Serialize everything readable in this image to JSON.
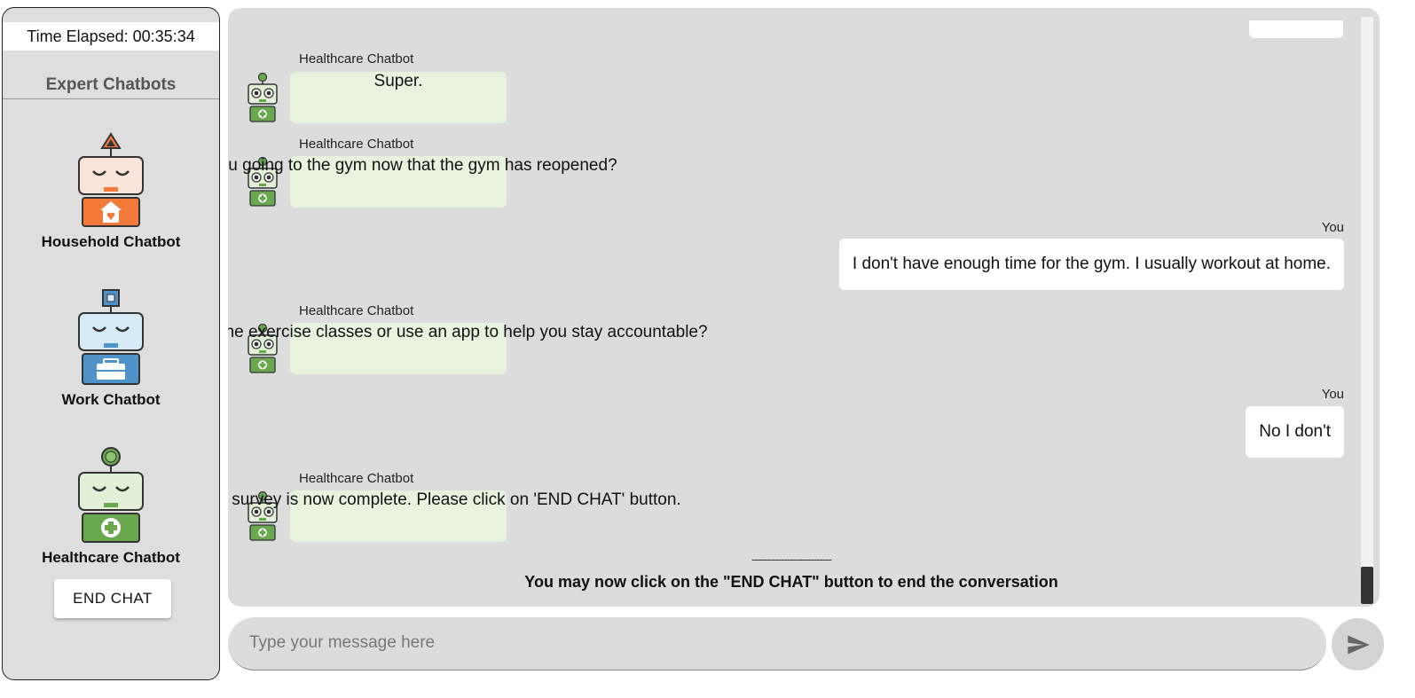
{
  "timer": {
    "label": "Time Elapsed: 00:35:34"
  },
  "sidebar": {
    "title": "Expert Chatbots",
    "bots": [
      {
        "name": "Household Chatbot",
        "icon": "household-robot-icon",
        "accent": "#f47a3a"
      },
      {
        "name": "Work Chatbot",
        "icon": "work-robot-icon",
        "accent": "#4f93c9"
      },
      {
        "name": "Healthcare Chatbot",
        "icon": "healthcare-robot-icon",
        "accent": "#6aa84f"
      }
    ],
    "end_button": "END CHAT"
  },
  "chat": {
    "messages": [
      {
        "from": "bot",
        "sender": "Healthcare Chatbot",
        "text": "Super."
      },
      {
        "from": "bot",
        "sender": "Healthcare Chatbot",
        "text": "Are you going to the gym now that the gym has reopened?"
      },
      {
        "from": "user",
        "sender": "You",
        "text": "I don't have enough time for the gym. I usually workout at home."
      },
      {
        "from": "bot",
        "sender": "Healthcare Chatbot",
        "text": "Do you attend online exercise classes or use an app to help you stay accountable?"
      },
      {
        "from": "user",
        "sender": "You",
        "text": "No I don't"
      },
      {
        "from": "bot",
        "sender": "Healthcare Chatbot",
        "text": "Thank you! the survey is now complete. Please click on 'END CHAT' button."
      }
    ],
    "end_separator": "---------------------------",
    "end_note": "You may now click on the \"END CHAT\" button to end the conversation"
  },
  "composer": {
    "placeholder": "Type your message here",
    "send_icon": "send-icon"
  },
  "colors": {
    "bot_bubble": "#e8f3df",
    "user_bubble": "#ffffff",
    "panel_bg": "#dcdcdc"
  }
}
